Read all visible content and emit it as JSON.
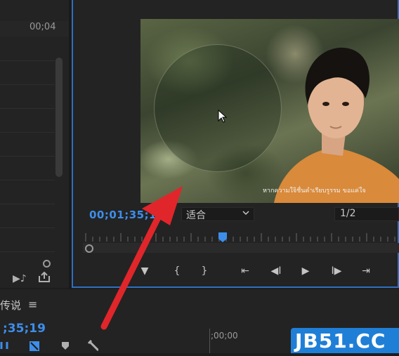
{
  "source_panel": {
    "timecode": "00;04",
    "icons": [
      "play-marker-icon",
      "export-frame-icon"
    ]
  },
  "program_monitor": {
    "subtitle": "หากความใจิชื่นคำเรียบรูรรม ขอแค่ใจ",
    "timecode": "00;01;35;1",
    "fit_label": "适合",
    "resolution_label": "1/2",
    "controls": [
      {
        "name": "add-marker-button",
        "icon": "marker-icon",
        "glyph": "▼"
      },
      {
        "name": "mark-in-button",
        "icon": "mark-in-icon",
        "glyph": "{"
      },
      {
        "name": "mark-out-button",
        "icon": "mark-out-icon",
        "glyph": "}"
      },
      {
        "name": "go-to-in-button",
        "icon": "go-to-in-icon",
        "glyph": "⇤"
      },
      {
        "name": "step-back-button",
        "icon": "step-back-icon",
        "glyph": "◀I"
      },
      {
        "name": "play-button",
        "icon": "play-icon",
        "glyph": "▶"
      },
      {
        "name": "step-forward-button",
        "icon": "step-forward-icon",
        "glyph": "I▶"
      },
      {
        "name": "go-to-out-button",
        "icon": "go-to-out-icon",
        "glyph": "⇥"
      }
    ]
  },
  "timeline": {
    "sequence_name": "传说",
    "menu_glyph": "≡",
    "timecode": ";35;19",
    "ruler_time": ";00;00",
    "icons": [
      "snap-icon",
      "linked-selection-icon",
      "add-marker-icon",
      "wrench-icon"
    ]
  },
  "watermark": {
    "text": "JB51.CC"
  },
  "colors": {
    "accent": "#3d8eea",
    "panel_border": "#2f6fc0",
    "annotation_arrow": "#e0262a",
    "watermark_bg": "#1f7fd6"
  }
}
